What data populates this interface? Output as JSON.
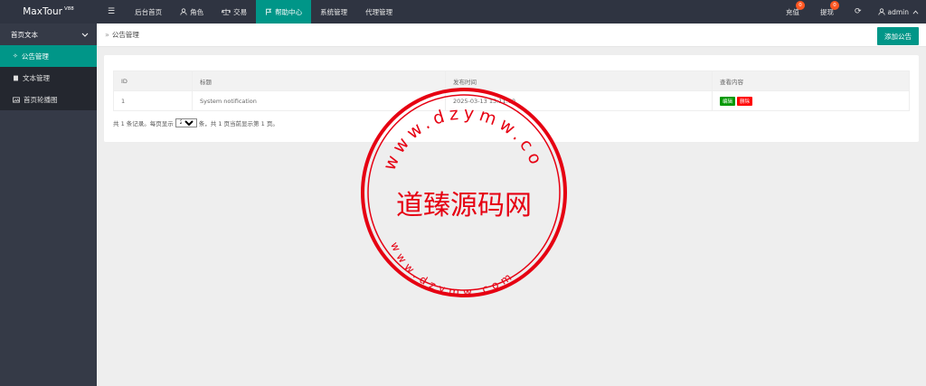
{
  "app": {
    "name": "MaxTour",
    "version": "V88"
  },
  "topnav": {
    "menu_icon": "menu-icon",
    "items": [
      {
        "label": "后台首页",
        "icon": ""
      },
      {
        "label": "角色",
        "icon": "user-icon"
      },
      {
        "label": "交易",
        "icon": "scale-icon"
      },
      {
        "label": "帮助中心",
        "icon": "flag-icon",
        "active": true
      },
      {
        "label": "系统管理",
        "icon": ""
      },
      {
        "label": "代理管理",
        "icon": ""
      }
    ],
    "right": {
      "recharge": {
        "label": "充值",
        "badge": "0"
      },
      "withdraw": {
        "label": "提现",
        "badge": "0"
      },
      "refresh_icon": "refresh-icon",
      "user": "admin"
    }
  },
  "sidebar": {
    "group": "首页文本",
    "items": [
      {
        "label": "公告管理",
        "icon": "announce-icon",
        "active": true
      },
      {
        "label": "文本管理",
        "icon": "book-icon"
      },
      {
        "label": "首页轮播图",
        "icon": "image-icon"
      }
    ]
  },
  "breadcrumb": {
    "title": "公告管理"
  },
  "actions": {
    "add": "添加公告"
  },
  "table": {
    "headers": [
      "ID",
      "标题",
      "发布时间",
      "查看内容"
    ],
    "rows": [
      {
        "id": "1",
        "title": "System notification",
        "time": "2025-03-13 13:11:00",
        "edit": "编辑",
        "delete": "删除"
      }
    ]
  },
  "pager": {
    "prefix": "共 1 条记录。每页显示",
    "per_page": "20",
    "suffix": "条，共 1 页当前显示第 1 页。"
  },
  "watermark": {
    "center": "道臻源码网",
    "top_arc": "www.dzymw.com",
    "bottom_arc": "www.dzymw.com",
    "color": "#e60012"
  },
  "colors": {
    "accent": "#009688",
    "topbar": "#2f3441",
    "sidebar": "#353a47",
    "edit": "#009900",
    "delete": "#ff0000"
  }
}
